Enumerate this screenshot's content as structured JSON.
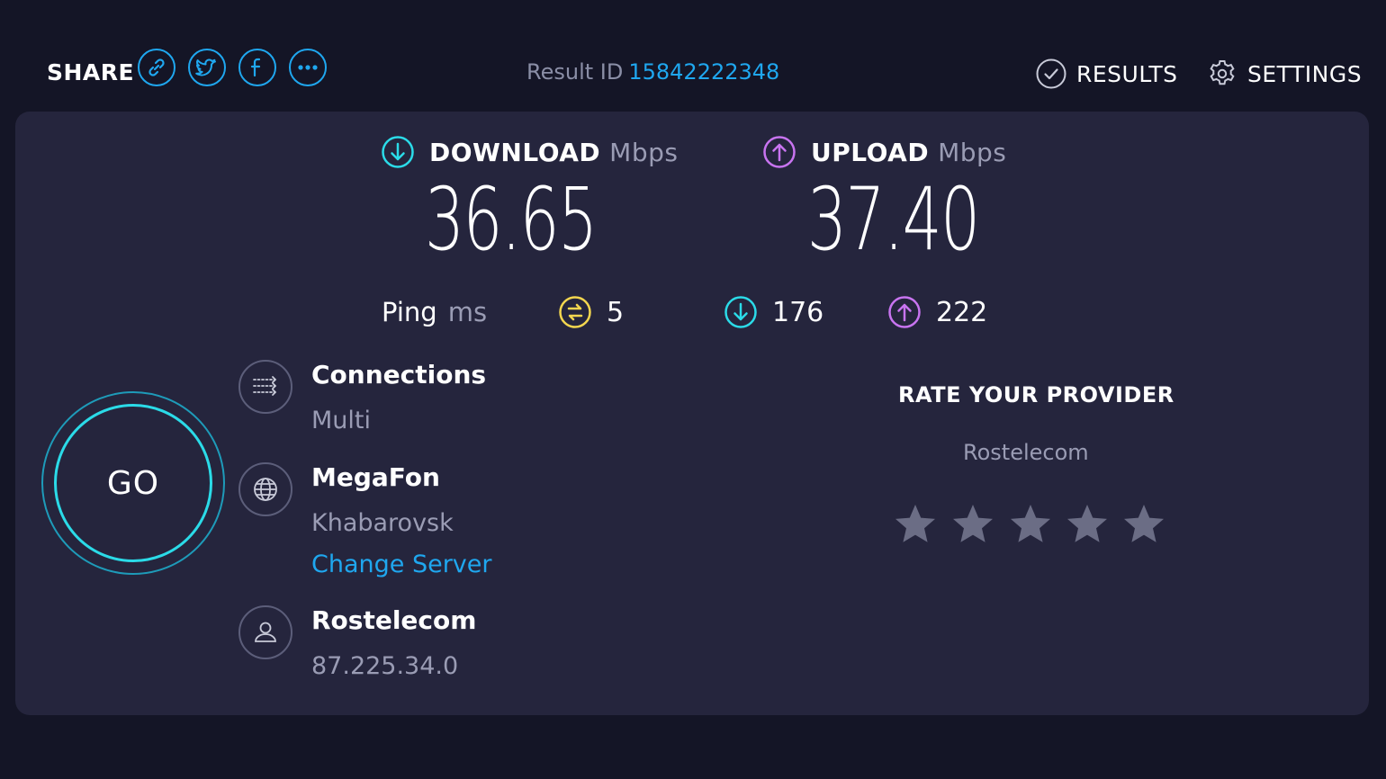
{
  "header": {
    "share_label": "SHARE",
    "share_icons": [
      "link-icon",
      "twitter-icon",
      "facebook-icon",
      "more-icon"
    ],
    "result_id_label": "Result ID",
    "result_id_value": "15842222348",
    "results_label": "RESULTS",
    "settings_label": "SETTINGS"
  },
  "download": {
    "label": "DOWNLOAD",
    "unit": "Mbps",
    "value": "36.65",
    "color": "#2bdbe8"
  },
  "upload": {
    "label": "UPLOAD",
    "unit": "Mbps",
    "value": "37.40",
    "color": "#c874f0"
  },
  "ping": {
    "label": "Ping",
    "unit": "ms",
    "idle": "5",
    "download": "176",
    "upload": "222",
    "idle_color": "#f3d64f"
  },
  "go_label": "GO",
  "connections": {
    "title": "Connections",
    "value": "Multi"
  },
  "server": {
    "title": "MegaFon",
    "location": "Khabarovsk",
    "change_label": "Change Server"
  },
  "provider": {
    "title": "Rostelecom",
    "ip": "87.225.34.0"
  },
  "rating": {
    "title": "RATE YOUR PROVIDER",
    "provider": "Rostelecom",
    "stars": 5,
    "filled": 0
  },
  "colors": {
    "accent": "#1fa7ef",
    "background": "#141526",
    "panel": "#25253d"
  }
}
